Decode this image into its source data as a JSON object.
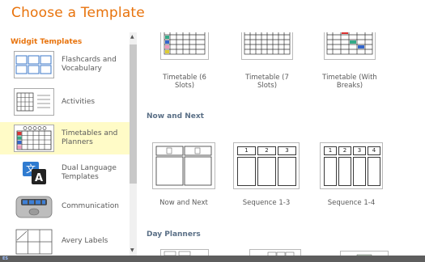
{
  "title": "Choose a Template",
  "sidebar": {
    "heading": "Widgit Templates",
    "items": [
      {
        "label": "Flashcards and Vocabulary",
        "icon": "flashcards-thumb",
        "selected": false
      },
      {
        "label": "Activities",
        "icon": "activities-thumb",
        "selected": false
      },
      {
        "label": "Timetables and Planners",
        "icon": "timetable-thumb",
        "selected": true
      },
      {
        "label": "Dual Language Templates",
        "icon": "translate-icon",
        "selected": false
      },
      {
        "label": "Communication",
        "icon": "communicator-device-icon",
        "selected": false
      },
      {
        "label": "Avery Labels",
        "icon": "labels-thumb",
        "selected": false
      }
    ]
  },
  "main": {
    "timetables": [
      {
        "caption": "Timetable (6 Slots)"
      },
      {
        "caption": "Timetable (7 Slots)"
      },
      {
        "caption": "Timetable (With Breaks)"
      }
    ],
    "sections": [
      {
        "title": "Now and Next",
        "items": [
          {
            "caption": "Now and Next"
          },
          {
            "caption": "Sequence 1-3",
            "numbers": [
              "1",
              "2",
              "3"
            ]
          },
          {
            "caption": "Sequence 1-4",
            "numbers": [
              "1",
              "2",
              "3",
              "4"
            ]
          }
        ]
      },
      {
        "title": "Day Planners",
        "items": []
      }
    ]
  },
  "statusbar": {
    "badge": "ES"
  },
  "colors": {
    "accent": "#e8730c",
    "section": "#5a6f86",
    "selected_bg": "#fffbc7"
  }
}
